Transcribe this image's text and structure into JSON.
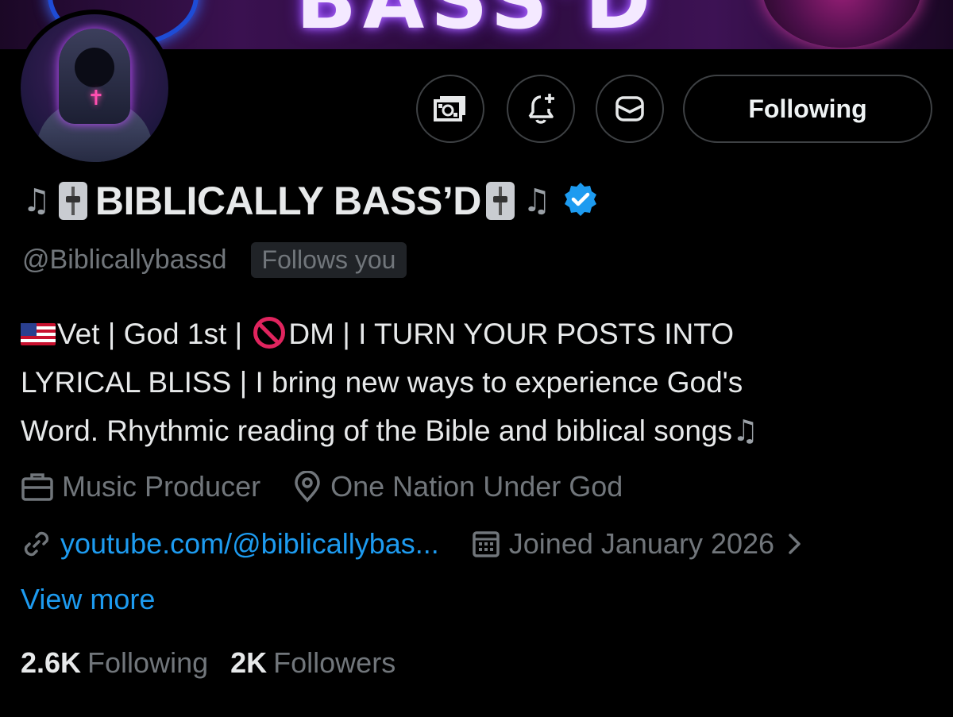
{
  "banner": {
    "text": "BASS'D"
  },
  "profile": {
    "display_name": "BIBLICALLY BASS’D",
    "handle": "@Biblicallybassd",
    "follows_you": "Follows you",
    "verified": true
  },
  "actions": {
    "following_label": "Following",
    "icons": [
      "tip-money-icon",
      "notification-bell-icon",
      "message-icon"
    ]
  },
  "bio": {
    "line1_part1": "Vet | God 1st | ",
    "line1_part2": "DM | I TURN YOUR POSTS INTO",
    "line2": "LYRICAL BLISS | I bring new ways to experience God's",
    "line3": "Word. Rhythmic reading of the Bible and biblical songs"
  },
  "meta": {
    "profession": "Music Producer",
    "location": "One Nation Under God",
    "website": "youtube.com/@biblicallybas...",
    "joined": "Joined January 2026"
  },
  "view_more": "View more",
  "stats": {
    "following_count": "2.6K",
    "following_label": "Following",
    "followers_count": "2K",
    "followers_label": "Followers"
  },
  "colors": {
    "accent": "#1d9bf0",
    "muted": "#71767b",
    "background": "#000000"
  }
}
